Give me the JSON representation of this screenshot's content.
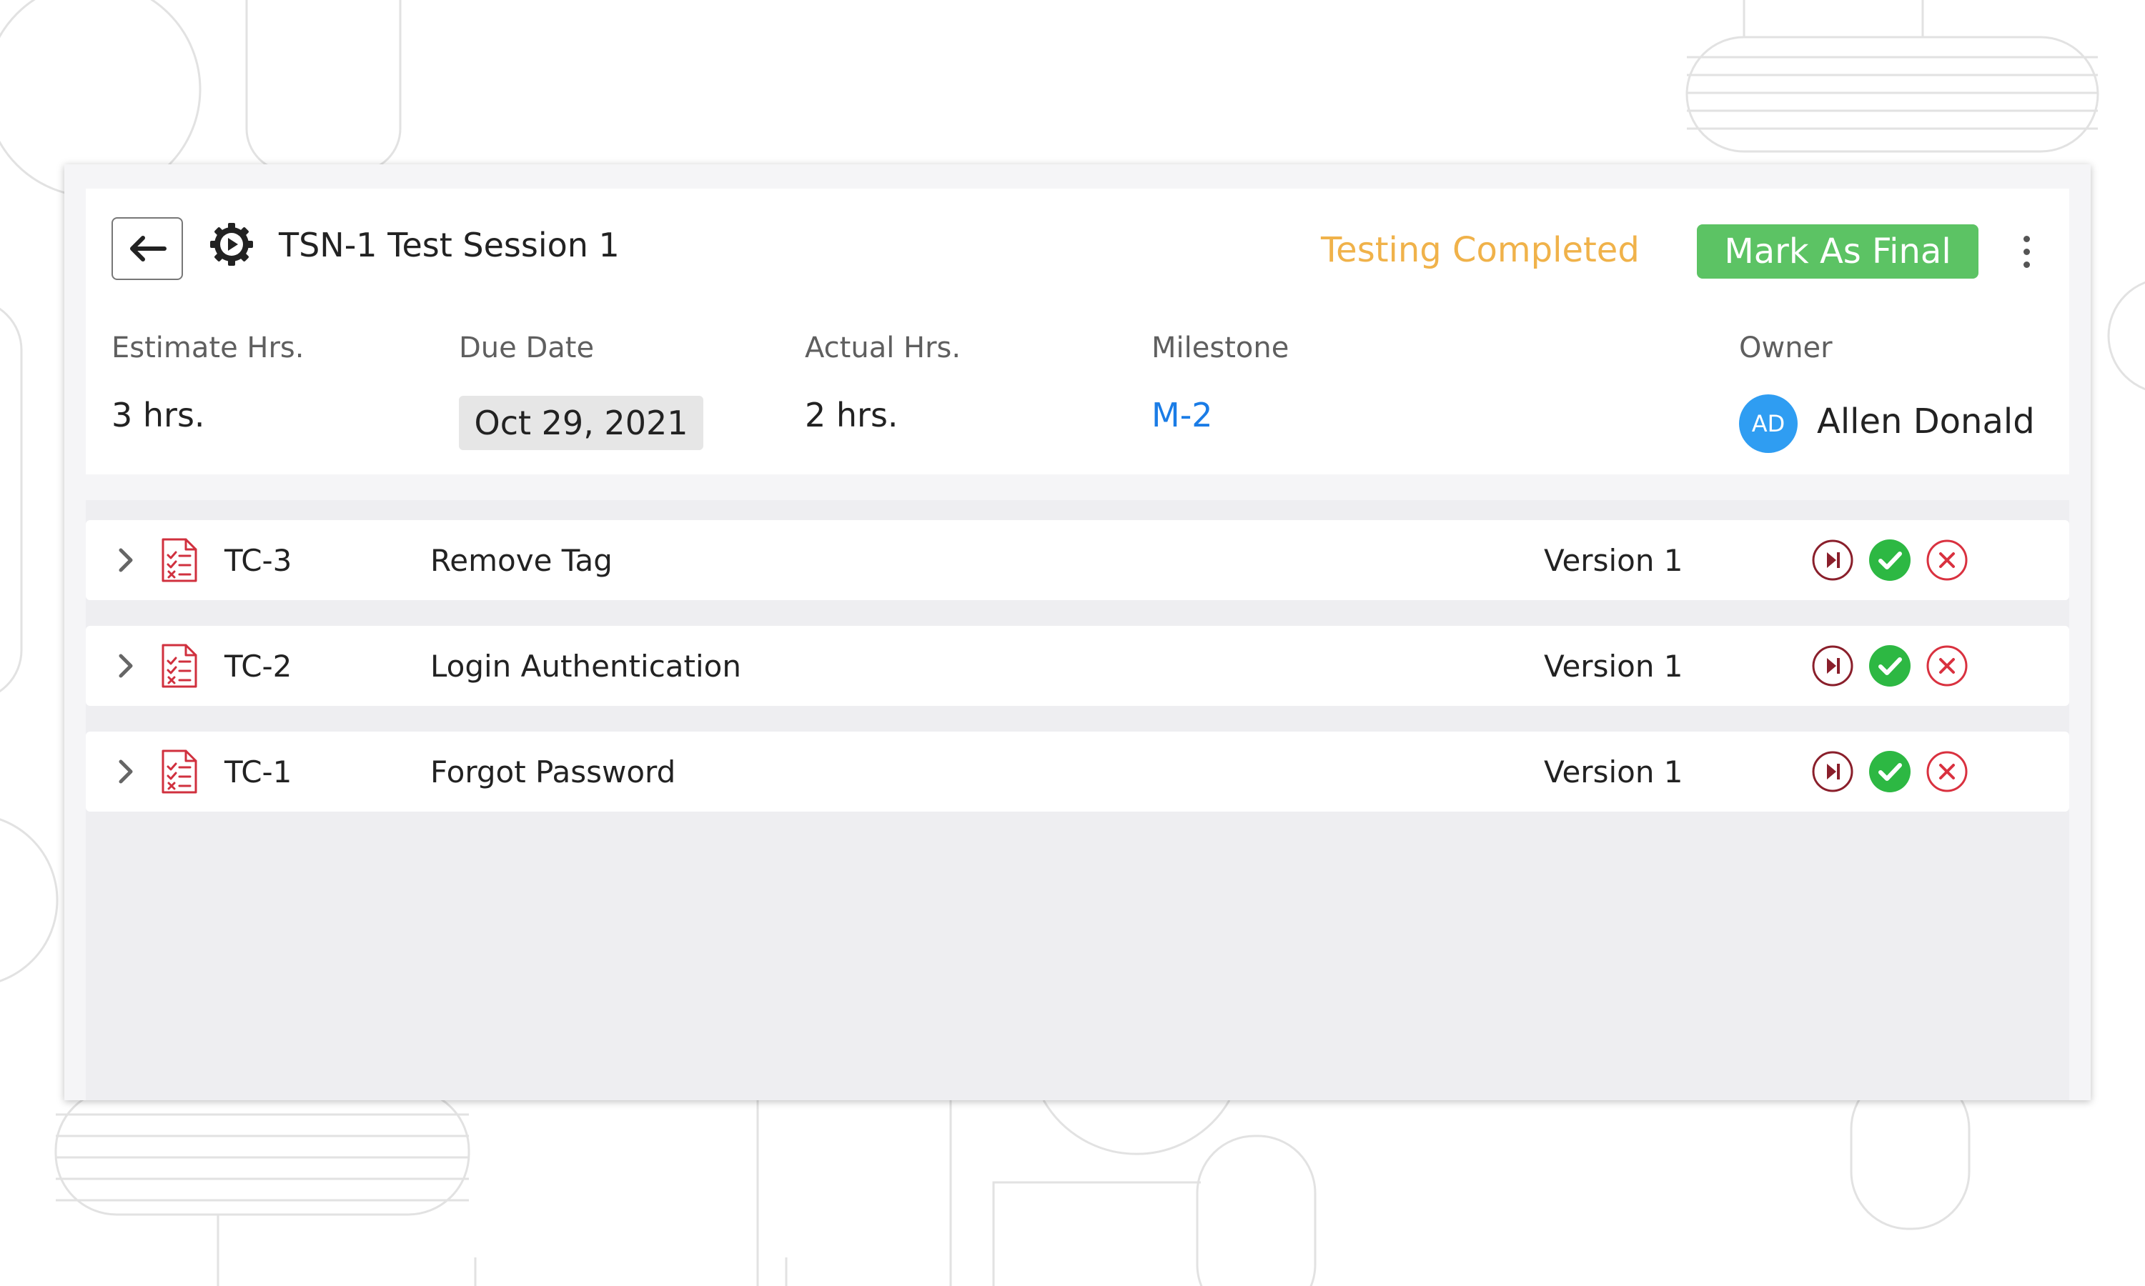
{
  "session": {
    "title": "TSN-1 Test Session 1",
    "status": "Testing Completed",
    "status_color": "#f0b24a",
    "mark_final_label": "Mark As Final",
    "mark_final_color": "#5cc364"
  },
  "meta": {
    "estimate": {
      "label": "Estimate Hrs.",
      "value": "3 hrs."
    },
    "due_date": {
      "label": "Due Date",
      "value": "Oct 29, 2021"
    },
    "actual": {
      "label": "Actual Hrs.",
      "value": "2 hrs."
    },
    "milestone": {
      "label": "Milestone",
      "value": "M-2",
      "color": "#1a7ce6"
    },
    "owner": {
      "label": "Owner",
      "initials": "AD",
      "name": "Allen Donald",
      "avatar_color": "#2f9df2"
    }
  },
  "test_cases": [
    {
      "id": "TC-3",
      "name": "Remove Tag",
      "version": "Version 1"
    },
    {
      "id": "TC-2",
      "name": "Login Authentication",
      "version": "Version 1"
    },
    {
      "id": "TC-1",
      "name": "Forgot Password",
      "version": "Version 1"
    }
  ],
  "icons": {
    "back": "arrow-left-icon",
    "session": "gear-play-icon",
    "more": "more-vertical-icon",
    "expand": "chevron-right-icon",
    "test_case": "checklist-document-icon",
    "skip": "skip-next-icon",
    "pass": "check-circle-icon",
    "fail": "close-circle-icon"
  },
  "colors": {
    "pass": "#2db843",
    "fail": "#d9313f",
    "skip": "#8a1f2b",
    "test_case_icon": "#d0303e"
  }
}
